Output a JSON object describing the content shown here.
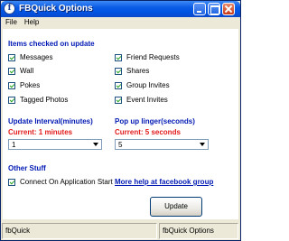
{
  "window": {
    "title": "FBQuick Options"
  },
  "menu": [
    "File",
    "Help"
  ],
  "items_section": {
    "title": "Items checked on update",
    "left": [
      {
        "label": "Messages",
        "checked": true
      },
      {
        "label": "Wall",
        "checked": true
      },
      {
        "label": "Pokes",
        "checked": true
      },
      {
        "label": "Tagged Photos",
        "checked": true
      }
    ],
    "right": [
      {
        "label": "Friend Requests",
        "checked": true
      },
      {
        "label": "Shares",
        "checked": true
      },
      {
        "label": "Group Invites",
        "checked": true
      },
      {
        "label": "Event Invites",
        "checked": true
      }
    ]
  },
  "update_interval": {
    "title": "Update Interval(minutes)",
    "current": "Current: 1 minutes",
    "value": "1"
  },
  "popup_linger": {
    "title": "Pop up linger(seconds)",
    "current": "Current: 5 seconds",
    "value": "5"
  },
  "other": {
    "title": "Other Stuff",
    "connect_label": "Connect On Application Start",
    "connect_checked": true
  },
  "help_link": "More help at facebook group",
  "update_button": "Update",
  "status": {
    "left": "fbQuick",
    "right": "fbQuick Options"
  },
  "colors": {
    "section": "#0019b3",
    "current": "#e21a1a",
    "titlebar": "#0054e3"
  }
}
